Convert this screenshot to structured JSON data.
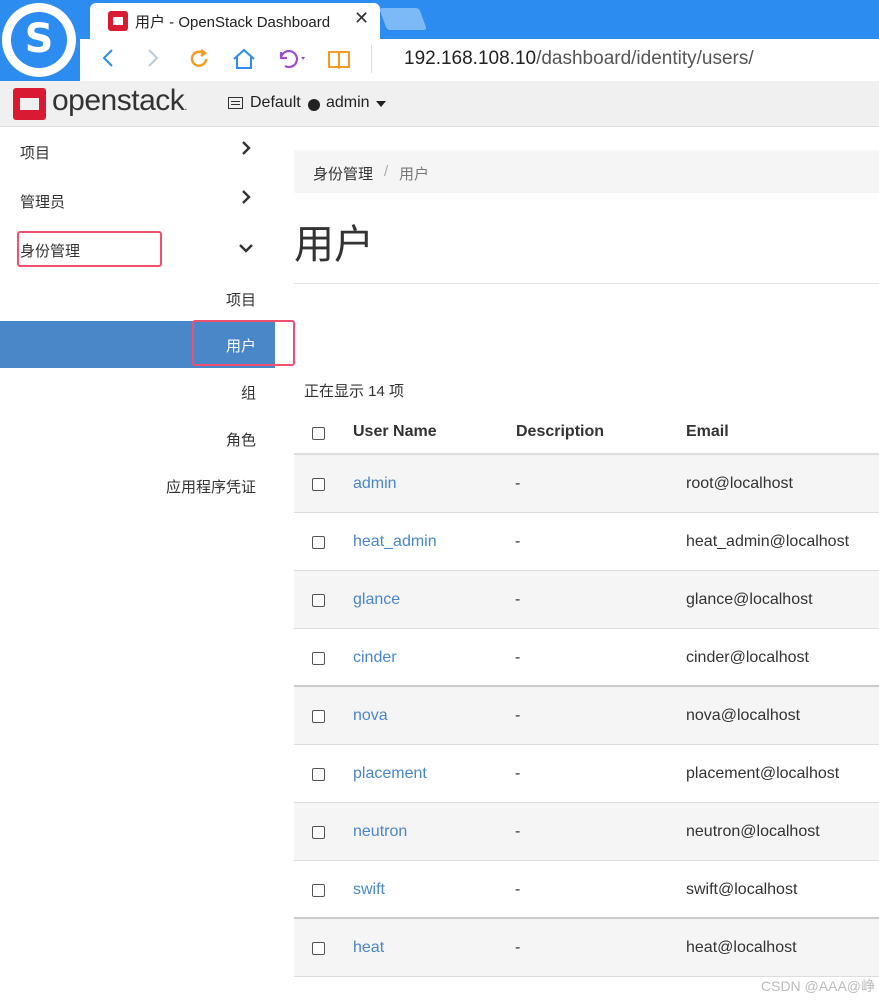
{
  "browser": {
    "tab_title": "用户 - OpenStack Dashboard",
    "tab_close": "✕",
    "url_host": "192.168.108.10",
    "url_path": "/dashboard/identity/users/",
    "logo_letter": "S"
  },
  "header": {
    "brand": "openstack",
    "brand_mark": ".",
    "domain": "Default",
    "project": "admin"
  },
  "sidebar": {
    "items": [
      {
        "label": "项目",
        "chevron": "›"
      },
      {
        "label": "管理员",
        "chevron": "›"
      },
      {
        "label": "身份管理",
        "chevron": "⌄"
      }
    ],
    "subitems": [
      {
        "label": "项目"
      },
      {
        "label": "用户"
      },
      {
        "label": "组"
      },
      {
        "label": "角色"
      },
      {
        "label": "应用程序凭证"
      }
    ]
  },
  "breadcrumb": {
    "parent": "身份管理",
    "separator": "/",
    "current": "用户"
  },
  "page": {
    "title": "用户",
    "count_text": "正在显示 14 项"
  },
  "table": {
    "columns": [
      "User Name",
      "Description",
      "Email"
    ],
    "rows": [
      {
        "name": "admin",
        "description": "-",
        "email": "root@localhost"
      },
      {
        "name": "heat_admin",
        "description": "-",
        "email": "heat_admin@localhost"
      },
      {
        "name": "glance",
        "description": "-",
        "email": "glance@localhost"
      },
      {
        "name": "cinder",
        "description": "-",
        "email": "cinder@localhost"
      },
      {
        "name": "nova",
        "description": "-",
        "email": "nova@localhost"
      },
      {
        "name": "placement",
        "description": "-",
        "email": "placement@localhost"
      },
      {
        "name": "neutron",
        "description": "-",
        "email": "neutron@localhost"
      },
      {
        "name": "swift",
        "description": "-",
        "email": "swift@localhost"
      },
      {
        "name": "heat",
        "description": "-",
        "email": "heat@localhost"
      }
    ]
  },
  "watermark": "CSDN @AAA@峥",
  "colors": {
    "browser_blue": "#2d8cf0",
    "openstack_red": "#da1a32",
    "active_blue": "#4a87c9",
    "highlight_red": "#f0506e"
  },
  "icons": {
    "back": "back-icon",
    "forward": "forward-icon",
    "reload": "reload-icon",
    "home": "home-icon",
    "undo": "undo-icon",
    "reader": "reader-icon",
    "domain": "domain-icon"
  }
}
